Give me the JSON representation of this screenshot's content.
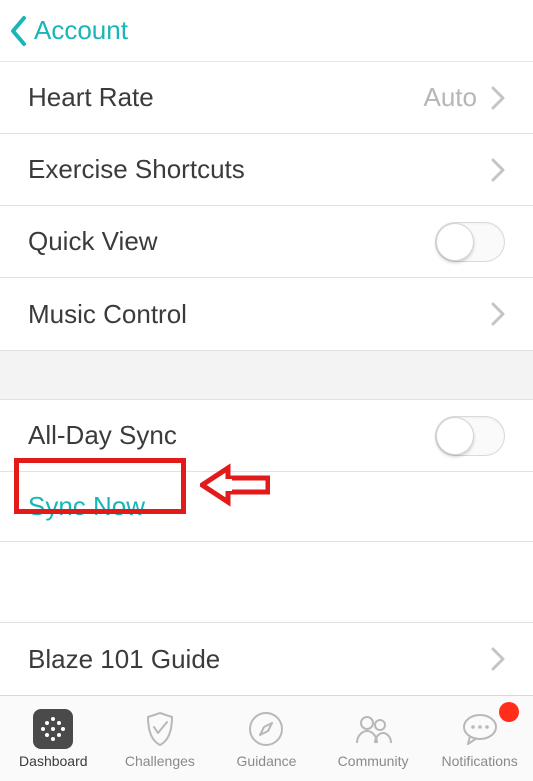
{
  "colors": {
    "accent": "#18b6b8",
    "annotation": "#e21a1a",
    "badge": "#ff2d1a"
  },
  "header": {
    "back_label": "Account"
  },
  "settings_section": {
    "rows": [
      {
        "label": "Heart Rate",
        "value": "Auto",
        "type": "disclosure"
      },
      {
        "label": "Exercise Shortcuts",
        "type": "disclosure"
      },
      {
        "label": "Quick View",
        "type": "toggle",
        "on": false
      },
      {
        "label": "Music Control",
        "type": "disclosure"
      }
    ]
  },
  "sync_section": {
    "rows": [
      {
        "label": "All-Day Sync",
        "type": "toggle",
        "on": false
      },
      {
        "label": "Sync Now",
        "type": "action"
      }
    ]
  },
  "guide_section": {
    "rows": [
      {
        "label": "Blaze 101 Guide",
        "type": "disclosure"
      }
    ]
  },
  "tabs": [
    {
      "label": "Dashboard",
      "icon": "dashboard-icon",
      "active": true
    },
    {
      "label": "Challenges",
      "icon": "shield-icon"
    },
    {
      "label": "Guidance",
      "icon": "compass-icon"
    },
    {
      "label": "Community",
      "icon": "people-icon"
    },
    {
      "label": "Notifications",
      "icon": "chat-icon",
      "badge": true
    }
  ],
  "annotation": {
    "target": "Sync Now"
  }
}
